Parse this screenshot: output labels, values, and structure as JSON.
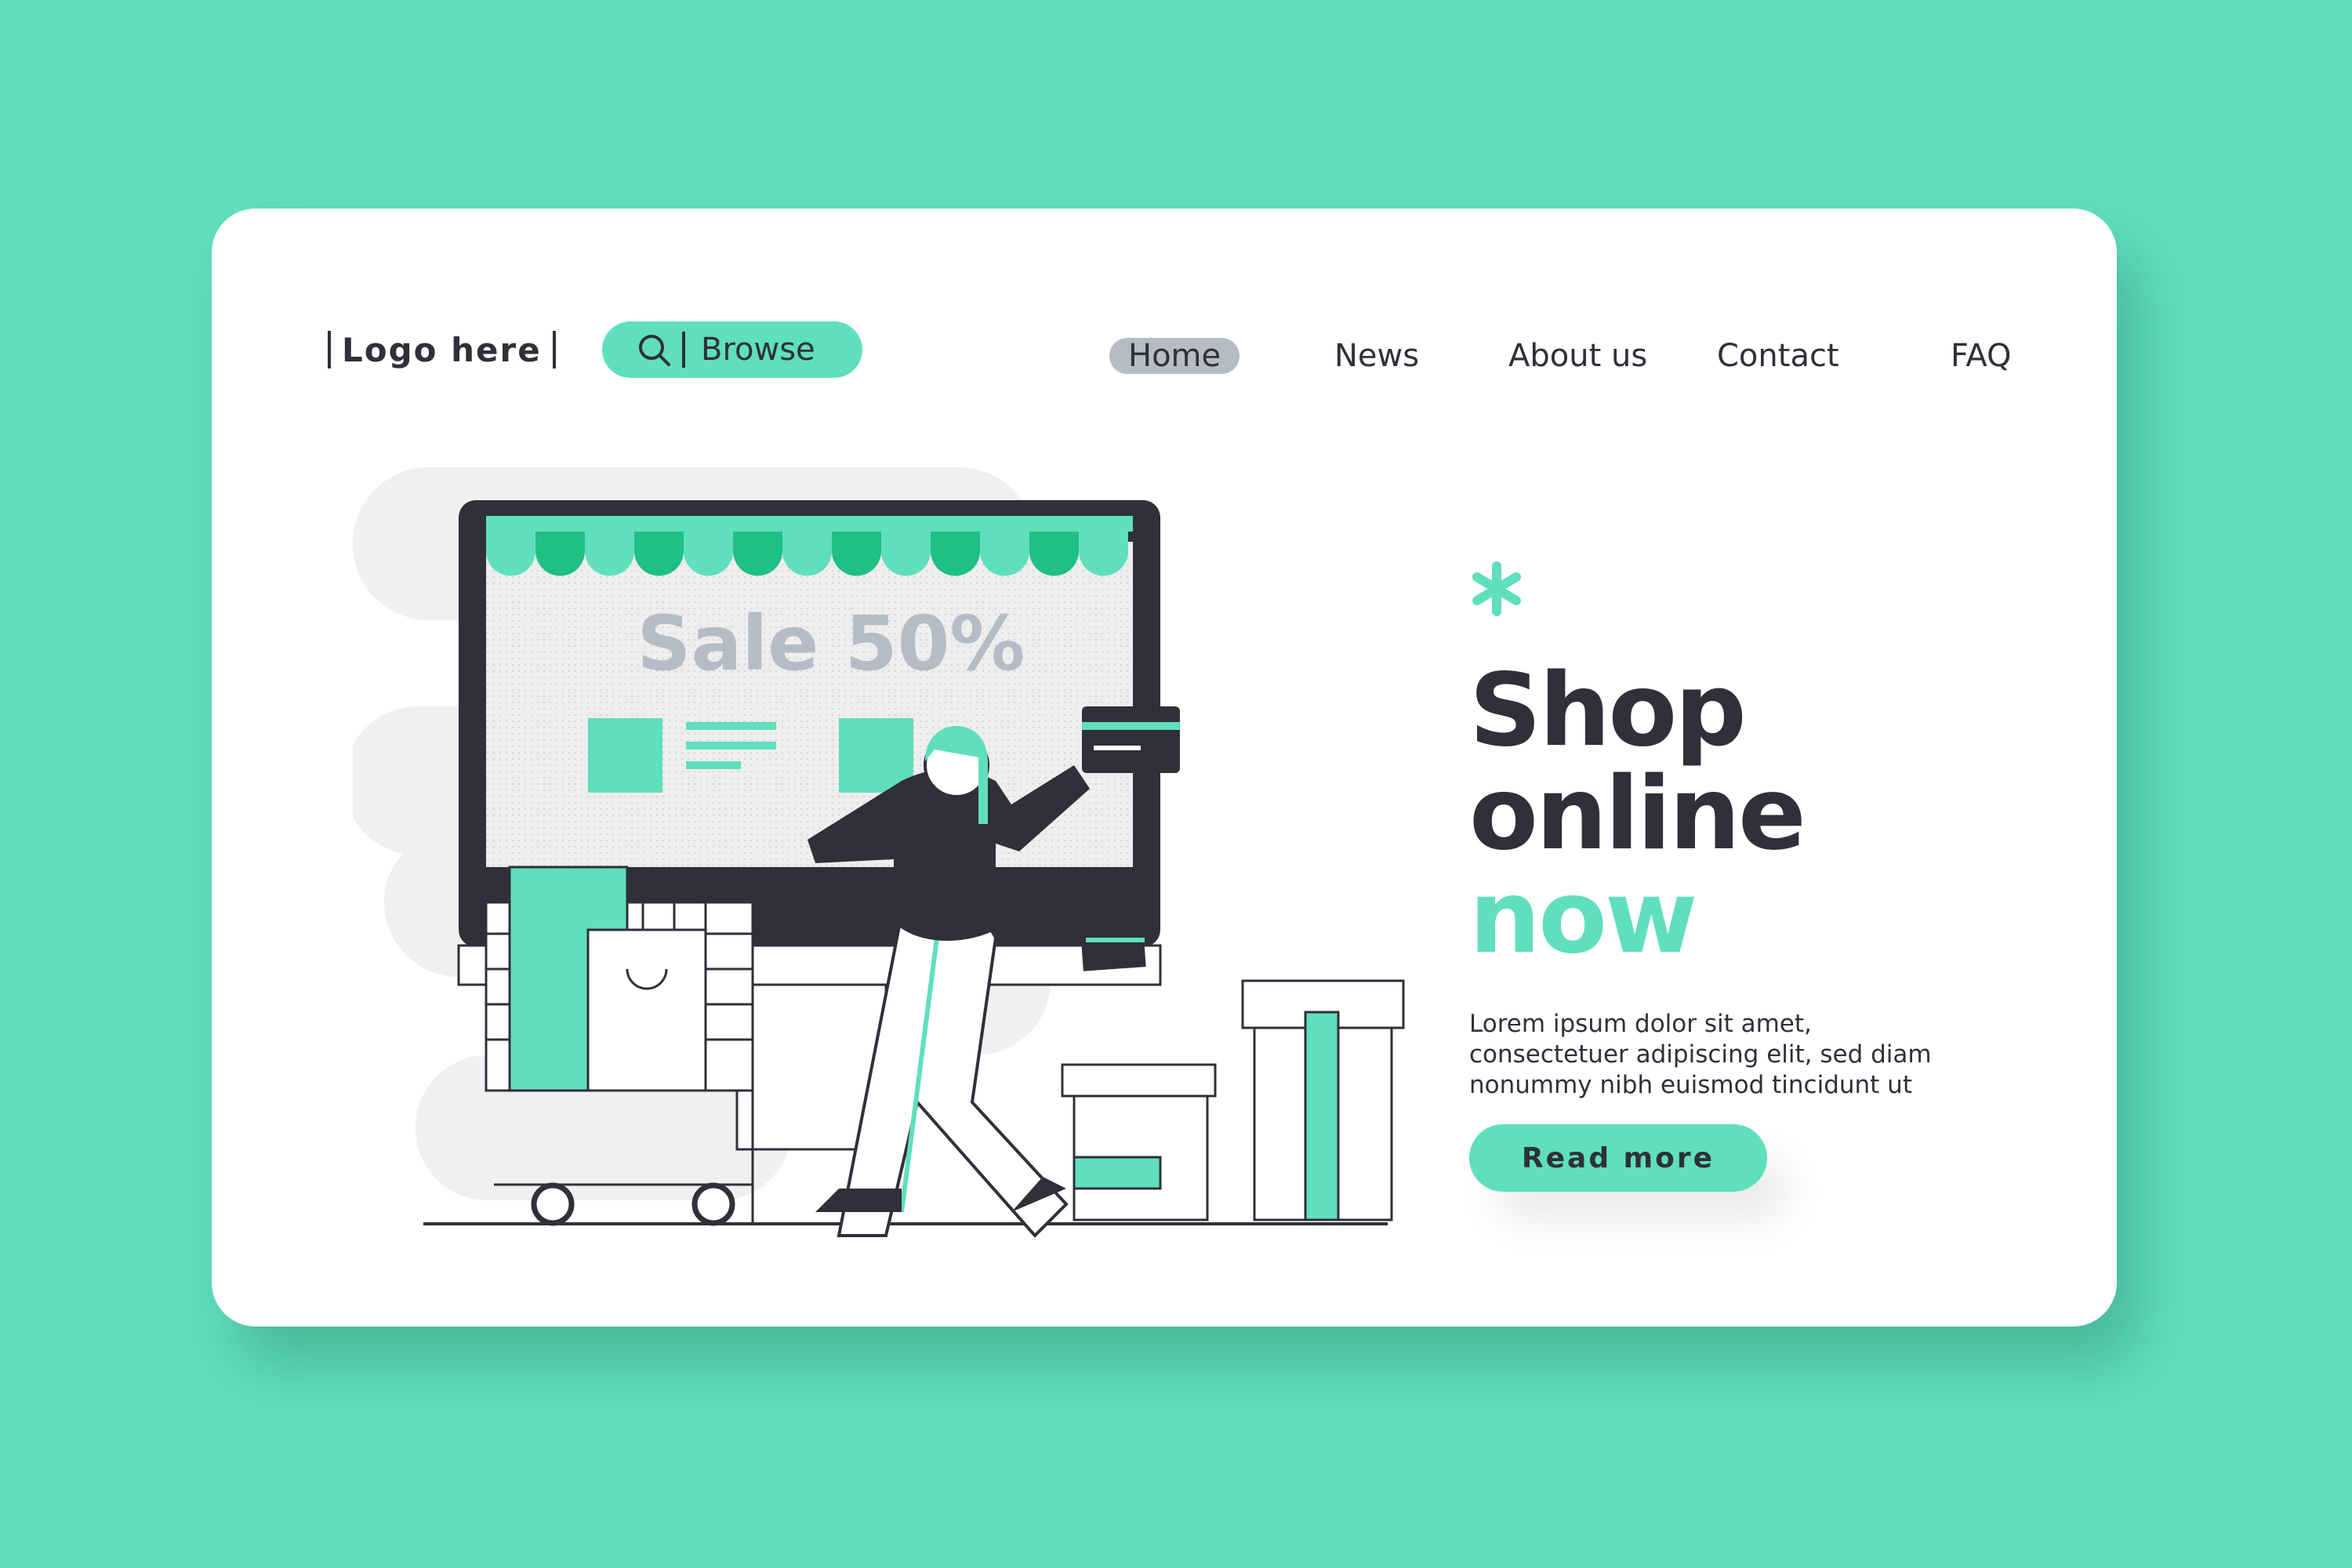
{
  "header": {
    "logo": "Logo here",
    "browse_label": "Browse",
    "nav": [
      {
        "label": "Home",
        "active": true
      },
      {
        "label": "News",
        "active": false
      },
      {
        "label": "About us",
        "active": false
      },
      {
        "label": "Contact",
        "active": false
      },
      {
        "label": "FAQ",
        "active": false
      }
    ]
  },
  "hero": {
    "title_line1": "Shop",
    "title_line2": "online",
    "title_line3": "now",
    "description": "Lorem ipsum dolor sit amet, consectetuer adipiscing elit, sed diam nonummy nibh euismod tincidunt ut",
    "button_label": "Read more"
  },
  "illustration": {
    "sale_text": "Sale 50%"
  },
  "colors": {
    "background": "#5fdfbd",
    "accent": "#5fdfbd",
    "accent_dark": "#1fbf85",
    "text": "#2f3039",
    "muted": "#b5bcc6"
  }
}
